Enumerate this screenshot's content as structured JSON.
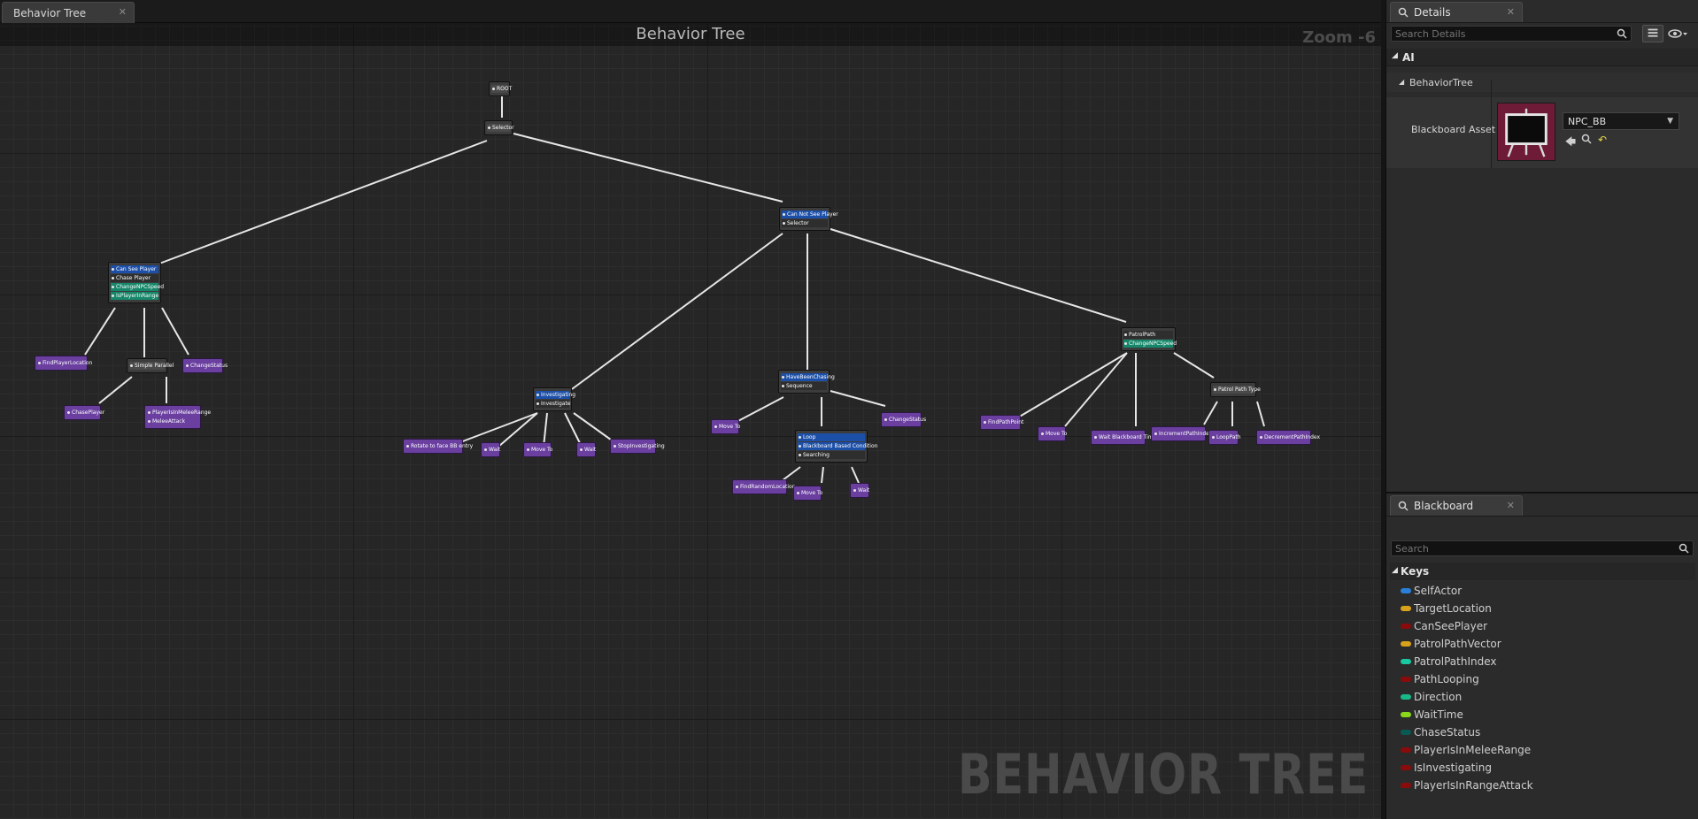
{
  "doc_tab": {
    "label": "Behavior Tree"
  },
  "graph": {
    "title": "Behavior Tree",
    "zoom": "Zoom -6",
    "watermark": "BEHAVIOR TREE",
    "nodes": {
      "root": "ROOT",
      "selector_top": "Selector",
      "can_see_player": "Can See Player",
      "chase_player": "Chase Player",
      "change_npc_speed_1": "ChangeNPCSpeed",
      "is_player_in_range": "IsPlayerInRange",
      "find_player_location": "FindPlayerLocation",
      "simple_parallel": "Simple Parallel",
      "change_status_1": "ChangeStatus",
      "chase_player_task": "ChasePlayer",
      "player_in_melee_range": "PlayerIsInMeleeRange",
      "melee_attack": "MeleeAttack",
      "can_not_see_player": "Can Not See Player",
      "selector_2": "Selector",
      "investigating": "Investigating",
      "investigate": "Investigate",
      "rotate_to_face": "Rotate to face BB entry",
      "wait_1": "Wait",
      "move_to_1": "Move To",
      "wait_2": "Wait",
      "stop_investigating": "StopInvestigating",
      "have_been_chasing": "HaveBeenChasing",
      "sequence": "Sequence",
      "move_to_2": "Move To",
      "change_status_2": "ChangeStatus",
      "loop": "Loop",
      "bb_condition": "Blackboard Based Condition",
      "searching": "Searching",
      "find_random_location": "FindRandomLocation",
      "move_to_3": "Move To",
      "wait_3": "Wait",
      "patrol_path": "PatrolPath",
      "change_npc_speed_2": "ChangeNPCSpeed",
      "patrol_path_type": "Patrol Path Type",
      "find_path_point": "FindPathPoint",
      "move_to_4": "Move To",
      "wait_bb_time": "Wait Blackboard Time",
      "increment_path_index": "IncrementPathIndex",
      "loop_path": "LoopPath",
      "decrement_path_index": "DecrementPathIndex"
    }
  },
  "details": {
    "tab_label": "Details",
    "search_placeholder": "Search Details",
    "category_ai": "AI",
    "subcategory": "BehaviorTree",
    "prop_label": "Blackboard Asset",
    "asset_value": "NPC_BB"
  },
  "blackboard": {
    "tab_label": "Blackboard",
    "search_placeholder": "Search",
    "keys_label": "Keys",
    "keys": [
      {
        "name": "SelfActor",
        "color": "#2a7fd6"
      },
      {
        "name": "TargetLocation",
        "color": "#d8a21a"
      },
      {
        "name": "CanSeePlayer",
        "color": "#8a0b0b"
      },
      {
        "name": "PatrolPathVector",
        "color": "#d8a21a"
      },
      {
        "name": "PatrolPathIndex",
        "color": "#18c8a0"
      },
      {
        "name": "PathLooping",
        "color": "#8a0b0b"
      },
      {
        "name": "Direction",
        "color": "#18b889"
      },
      {
        "name": "WaitTime",
        "color": "#8ad61a"
      },
      {
        "name": "ChaseStatus",
        "color": "#0a5a54"
      },
      {
        "name": "PlayerIsInMeleeRange",
        "color": "#8a0b0b"
      },
      {
        "name": "IsInvestigating",
        "color": "#8a0b0b"
      },
      {
        "name": "PlayerIsInRangeAttack",
        "color": "#8a0b0b"
      }
    ]
  }
}
